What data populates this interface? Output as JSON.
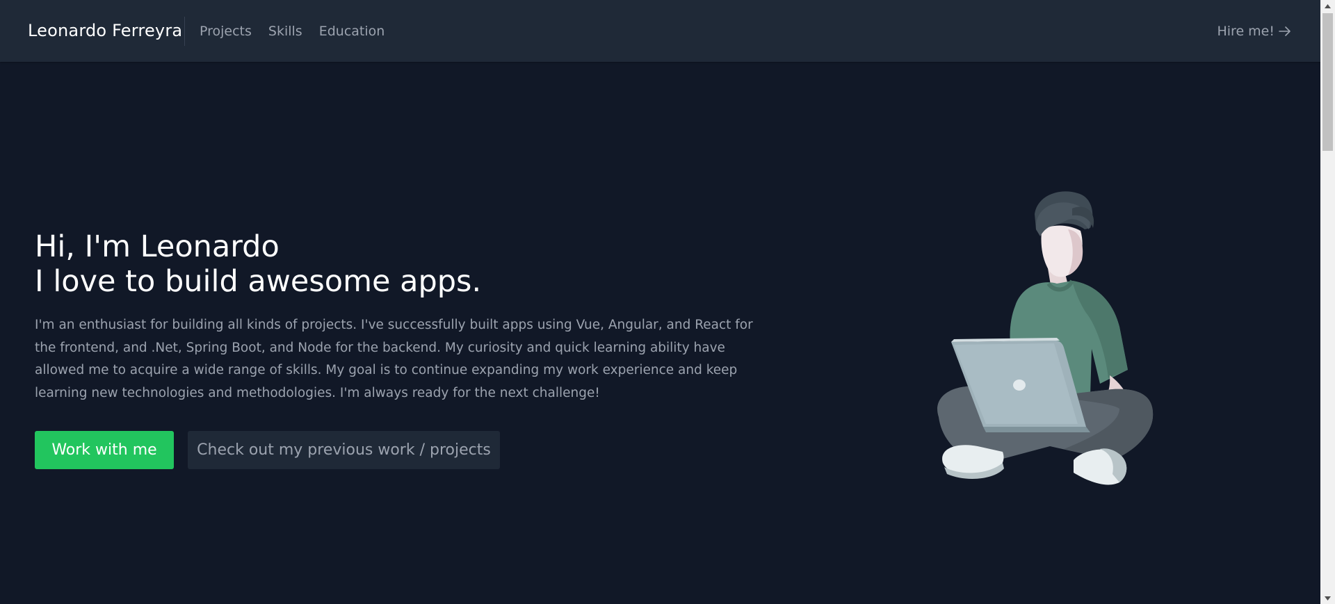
{
  "header": {
    "brand": "Leonardo Ferreyra",
    "nav": [
      "Projects",
      "Skills",
      "Education"
    ],
    "hire_label": "Hire me!",
    "hire_icon": "arrow-right-icon"
  },
  "hero": {
    "title_line1": "Hi, I'm Leonardo",
    "title_line2": "I love to build awesome apps.",
    "description": "I'm an enthusiast for building all kinds of projects. I've successfully built apps using Vue, Angular, and React for the frontend, and .Net, Spring Boot, and Node for the backend. My curiosity and quick learning ability have allowed me to acquire a wide range of skills. My goal is to continue expanding my work experience and keep learning new technologies and methodologies. I'm always ready for the next challenge!",
    "primary_button": "Work with me",
    "secondary_button": "Check out my previous work / projects",
    "illustration": "person-with-laptop-illustration"
  },
  "colors": {
    "background": "#111827",
    "header": "#1f2937",
    "accent": "#22c55e",
    "muted_text": "#9ca3af"
  }
}
